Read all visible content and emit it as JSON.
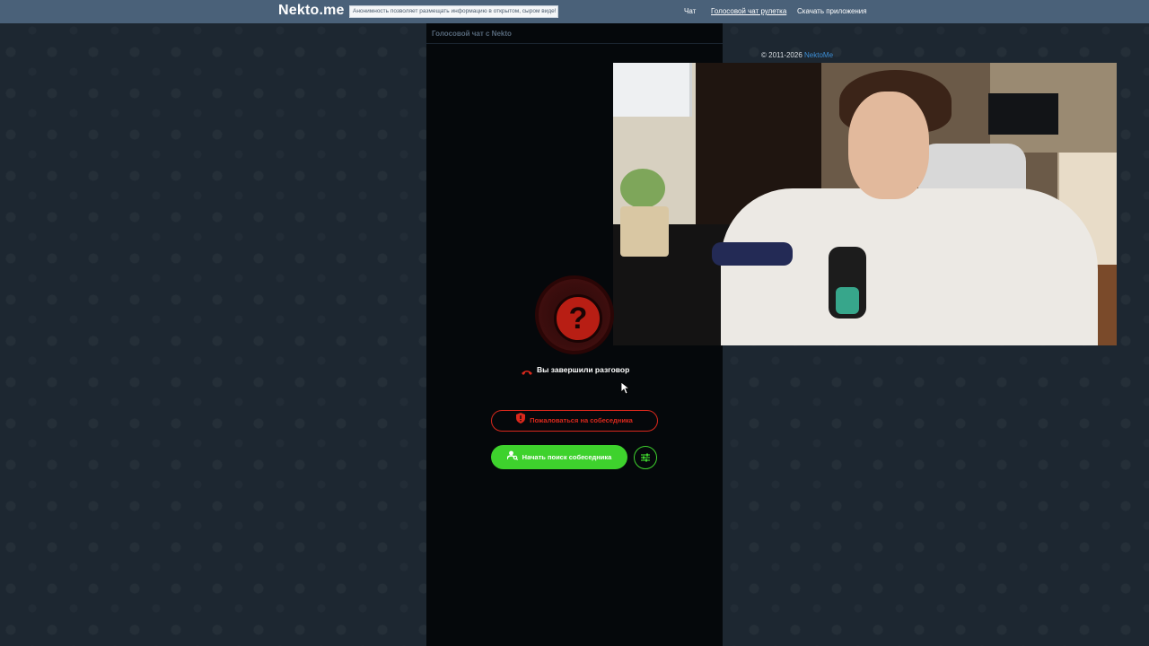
{
  "header": {
    "logo": "Nekto.me",
    "notice": "Анонимность позволяет размещать информацию в открытом, сыром виде!",
    "nav": [
      {
        "label": "Чат",
        "active": false
      },
      {
        "label": "Голосовой чат рулетка",
        "active": true
      },
      {
        "label": "Скачать приложения",
        "active": false
      }
    ]
  },
  "chat": {
    "heading": "Голосовой чат с Nekto",
    "status_icon": "question-mark-icon",
    "status_glyph": "?",
    "ended_text": "Вы завершили разговор",
    "report_label": "Пожаловаться на собеседника",
    "search_label": "Начать поиск собеседника"
  },
  "footer": {
    "copyright": "© 2011-2026",
    "brand": "NektoMe"
  },
  "colors": {
    "header_bg": "#4a6179",
    "page_bg": "#1d2731",
    "chat_bg": "#05080b",
    "danger": "#d9281c",
    "success": "#3ed22d",
    "link": "#3d8fd6"
  }
}
